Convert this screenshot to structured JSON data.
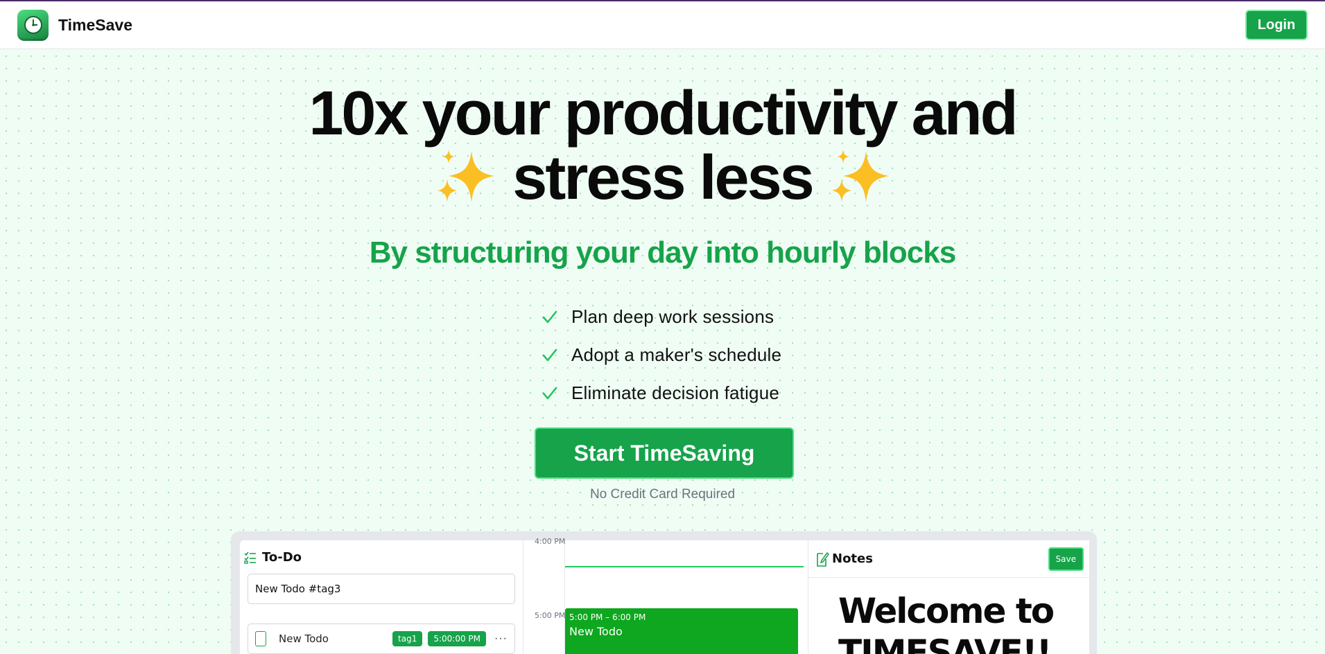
{
  "header": {
    "brand_name": "TimeSave",
    "login_label": "Login"
  },
  "hero": {
    "headline_line1": "10x your productivity and",
    "headline_line2": "stress less",
    "subheadline": "By structuring your day into hourly blocks",
    "features": [
      "Plan deep work sessions",
      "Adopt a maker's schedule",
      "Eliminate decision fatigue"
    ],
    "cta_label": "Start TimeSaving",
    "cta_note": "No Credit Card Required"
  },
  "preview": {
    "todo": {
      "title": "To-Do",
      "input_value": "New Todo #tag3",
      "items": [
        {
          "name": "New Todo",
          "tag": "tag1",
          "time": "5:00:00 PM",
          "menu": "···"
        }
      ]
    },
    "calendar": {
      "time_labels": [
        "4:00 PM",
        "5:00 PM"
      ],
      "event": {
        "time": "5:00 PM – 6:00 PM",
        "title": "New Todo"
      }
    },
    "notes": {
      "title": "Notes",
      "save_label": "Save",
      "body_line1": "Welcome to",
      "body_line2": "TIMESAVE!!"
    }
  },
  "colors": {
    "accent": "#16a34a",
    "accent_light": "#4ade80",
    "background": "#effdf4",
    "event": "#0ea71f"
  },
  "icons": {
    "logo": "clock-logo-icon",
    "sparkles": "sparkles-icon",
    "check": "check-icon",
    "todo": "checklist-icon",
    "notes": "note-pencil-icon"
  }
}
